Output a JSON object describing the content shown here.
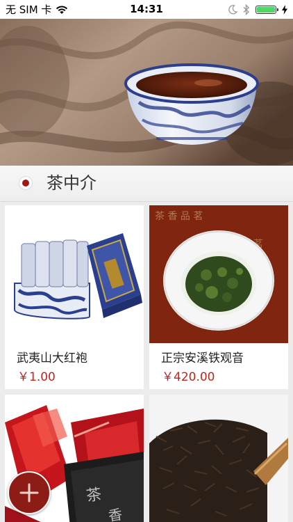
{
  "status_bar": {
    "carrier": "无 SIM 卡",
    "time": "14:31",
    "battery_level": 1.0,
    "wifi_icon": "wifi-icon",
    "moon_icon": "moon-icon",
    "bluetooth_icon": "bluetooth-icon",
    "charging_icon": "bolt-icon"
  },
  "banner": {
    "image": "tea-cup-banner"
  },
  "section": {
    "title": "茶中介",
    "accent_color": "#9e1b15"
  },
  "products": [
    {
      "name": "武夷山大红袍",
      "price": "￥1.00",
      "image": "tea-tin-blue-white"
    },
    {
      "name": "正宗安溪铁观音",
      "price": "￥420.00",
      "image": "tieguanyin-bowl"
    },
    {
      "name": "",
      "price": "",
      "image": "red-tea-packets-tin"
    },
    {
      "name": "",
      "price": "",
      "image": "loose-black-tea-scoop"
    }
  ],
  "fab": {
    "icon": "plus-icon",
    "color": "#8e1c16"
  },
  "colors": {
    "price": "#c5221a",
    "background": "#ececec"
  }
}
